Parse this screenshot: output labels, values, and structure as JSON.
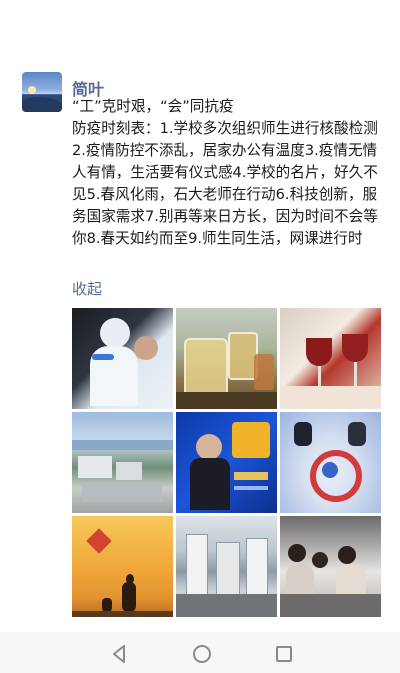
{
  "post": {
    "author": "简叶",
    "title_line": "“工”克时艰，“会”同抗疫",
    "body": "防疫时刻表：1.学校多次组织师生进行核酸检测2.疫情防控不添乱，居家办公有温度3.疫情无情人有情，生活要有仪式感4.学校的名片，好久不见5.春风化雨，石大老师在行动6.科技创新，服务国家需求7.别再等来日方长，因为时间不会等你8.春天如约而至9.师生同生活，网课进行时",
    "collapse_label": "收起"
  },
  "photos": [
    {
      "icon": "medical-worker-photo"
    },
    {
      "icon": "teapot-photo"
    },
    {
      "icon": "wine-glasses-photo"
    },
    {
      "icon": "campus-aerial-photo"
    },
    {
      "icon": "poster-photo"
    },
    {
      "icon": "curling-game-photo"
    },
    {
      "icon": "kite-sunset-photo"
    },
    {
      "icon": "buildings-photo"
    },
    {
      "icon": "classroom-photo"
    }
  ],
  "navbar": {
    "back": "back-icon",
    "home": "home-icon",
    "recents": "recents-icon"
  }
}
